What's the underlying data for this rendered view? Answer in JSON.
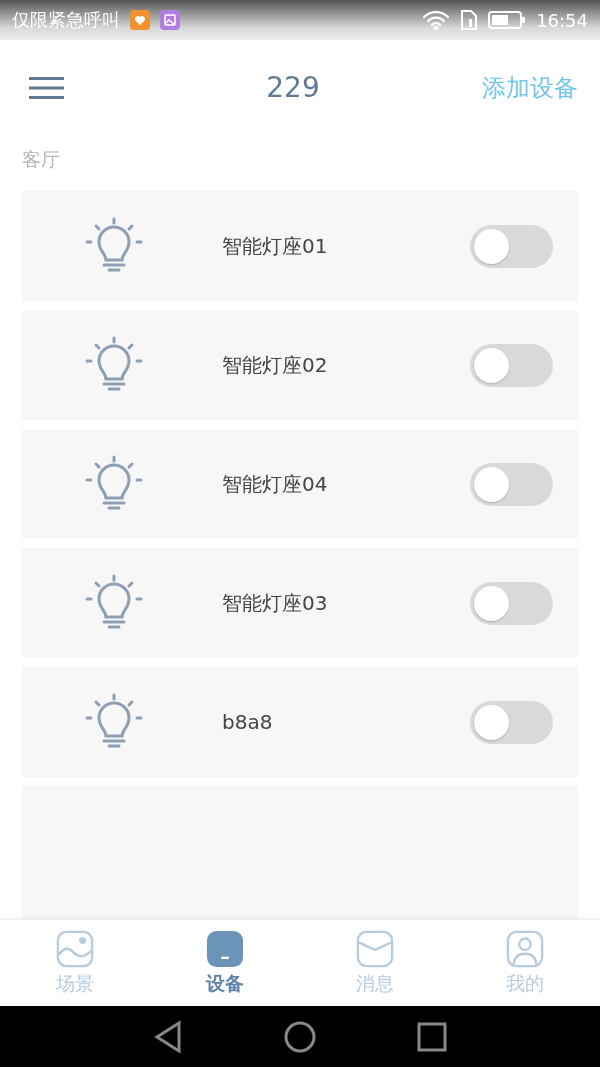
{
  "status_bar": {
    "carrier": "仅限紧急呼叫",
    "time": "16:54"
  },
  "header": {
    "title": "229",
    "action": "添加设备"
  },
  "room": "客厅",
  "devices": [
    {
      "name": "智能灯座01",
      "on": false
    },
    {
      "name": "智能灯座02",
      "on": false
    },
    {
      "name": "智能灯座04",
      "on": false
    },
    {
      "name": "智能灯座03",
      "on": false
    },
    {
      "name": "b8a8",
      "on": false
    }
  ],
  "tabs": [
    {
      "kind": "scene",
      "label": "场景",
      "selected": false
    },
    {
      "kind": "device",
      "label": "设备",
      "selected": true
    },
    {
      "kind": "message",
      "label": "消息",
      "selected": false
    },
    {
      "kind": "profile",
      "label": "我的",
      "selected": false
    }
  ]
}
